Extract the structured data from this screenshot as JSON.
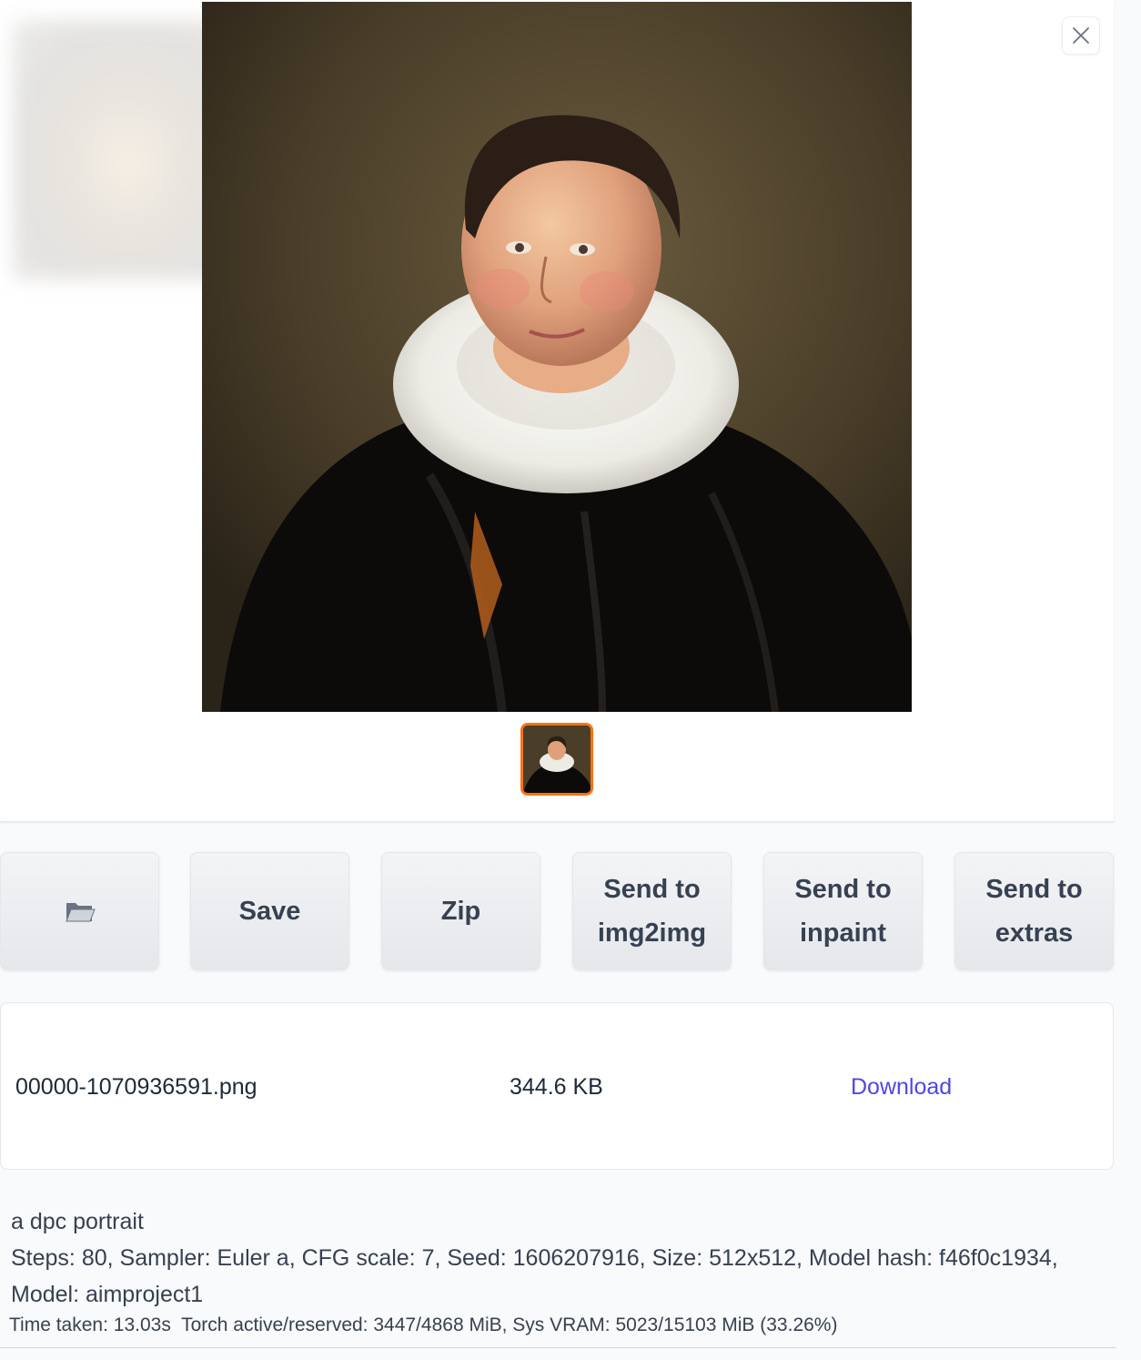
{
  "gallery": {
    "close_icon": "close-icon",
    "image_alt": "generated portrait",
    "accent_color": "#f97316"
  },
  "buttons": {
    "folder_icon": "folder-icon",
    "save_label": "Save",
    "zip_label": "Zip",
    "send_img2img_line1": "Send to",
    "send_img2img_line2": "img2img",
    "send_inpaint_line1": "Send to",
    "send_inpaint_line2": "inpaint",
    "send_extras_line1": "Send to",
    "send_extras_line2": "extras"
  },
  "file": {
    "name": "00000-1070936591.png",
    "size": "344.6 KB",
    "download_label": "Download",
    "link_color": "#4f46e5"
  },
  "generation": {
    "prompt": "a dpc portrait",
    "params": "Steps: 80, Sampler: Euler a, CFG scale: 7, Seed: 1606207916, Size: 512x512, Model hash: f46f0c1934, Model: aimproject1",
    "timing": "Time taken: 13.03s  Torch active/reserved: 3447/4868 MiB, Sys VRAM: 5023/15103 MiB (33.26%)"
  }
}
